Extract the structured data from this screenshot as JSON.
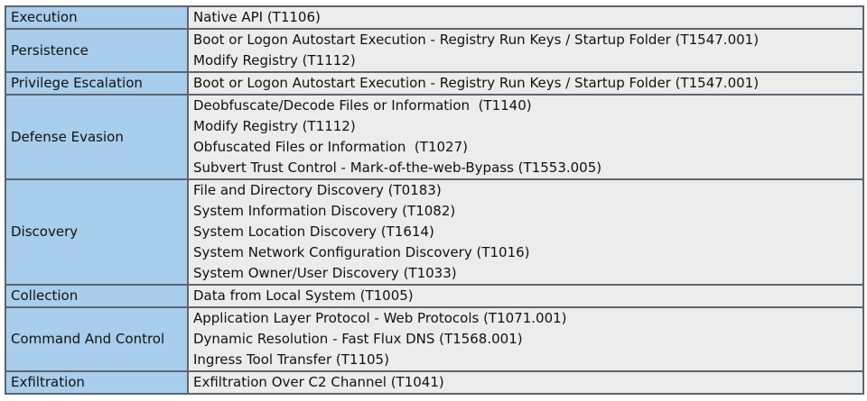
{
  "rows": [
    {
      "tactic": "Execution",
      "techniques": [
        "Native API (T1106)"
      ]
    },
    {
      "tactic": "Persistence",
      "techniques": [
        "Boot or Logon Autostart Execution - Registry Run Keys / Startup Folder (T1547.001)",
        "Modify Registry (T1112)"
      ]
    },
    {
      "tactic": "Privilege Escalation",
      "techniques": [
        "Boot or Logon Autostart Execution - Registry Run Keys / Startup Folder (T1547.001)"
      ]
    },
    {
      "tactic": "Defense Evasion",
      "techniques": [
        "Deobfuscate/Decode Files or Information  (T1140)",
        "Modify Registry (T1112)",
        "Obfuscated Files or Information  (T1027)",
        "Subvert Trust Control - Mark-of-the-web-Bypass (T1553.005)"
      ]
    },
    {
      "tactic": "Discovery",
      "techniques": [
        "File and Directory Discovery (T0183)",
        "System Information Discovery (T1082)",
        "System Location Discovery (T1614)",
        "System Network Configuration Discovery (T1016)",
        "System Owner/User Discovery (T1033)"
      ]
    },
    {
      "tactic": "Collection",
      "techniques": [
        "Data from Local System (T1005)"
      ]
    },
    {
      "tactic": "Command And Control",
      "techniques": [
        "Application Layer Protocol - Web Protocols (T1071.001)",
        "Dynamic Resolution - Fast Flux DNS (T1568.001)",
        "Ingress Tool Transfer (T1105)"
      ]
    },
    {
      "tactic": "Exfiltration",
      "techniques": [
        "Exfiltration Over C2 Channel (T1041)"
      ]
    }
  ],
  "colors": {
    "tactic_bg": "#a9cdec",
    "technique_bg": "#ececec",
    "border": "#5b6672"
  }
}
